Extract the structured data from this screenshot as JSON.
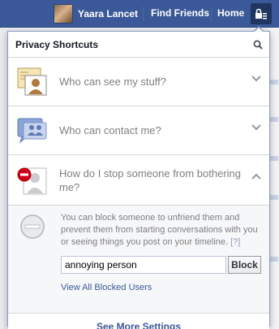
{
  "topbar": {
    "user_name": "Yaara Lancet",
    "find_friends": "Find Friends",
    "home": "Home"
  },
  "panel": {
    "title": "Privacy Shortcuts",
    "items": [
      {
        "label": "Who can see my stuff?",
        "icon": "profile-card-icon",
        "expanded": false
      },
      {
        "label": "Who can contact me?",
        "icon": "chat-people-icon",
        "expanded": false
      },
      {
        "label": "How do I stop someone from bothering me?",
        "icon": "blocked-user-icon",
        "expanded": true
      }
    ],
    "block_section": {
      "description": "You can block someone to unfriend them and prevent them from starting conversations with you or seeing things you post on your timeline.",
      "help_link": "[?]",
      "input_value": "annoying person",
      "block_button": "Block",
      "view_blocked_link": "View All Blocked Users"
    },
    "footer_link": "See More Settings"
  },
  "colors": {
    "topbar": "#3b5998",
    "link": "#3b5998",
    "block_red": "#d0021b"
  }
}
